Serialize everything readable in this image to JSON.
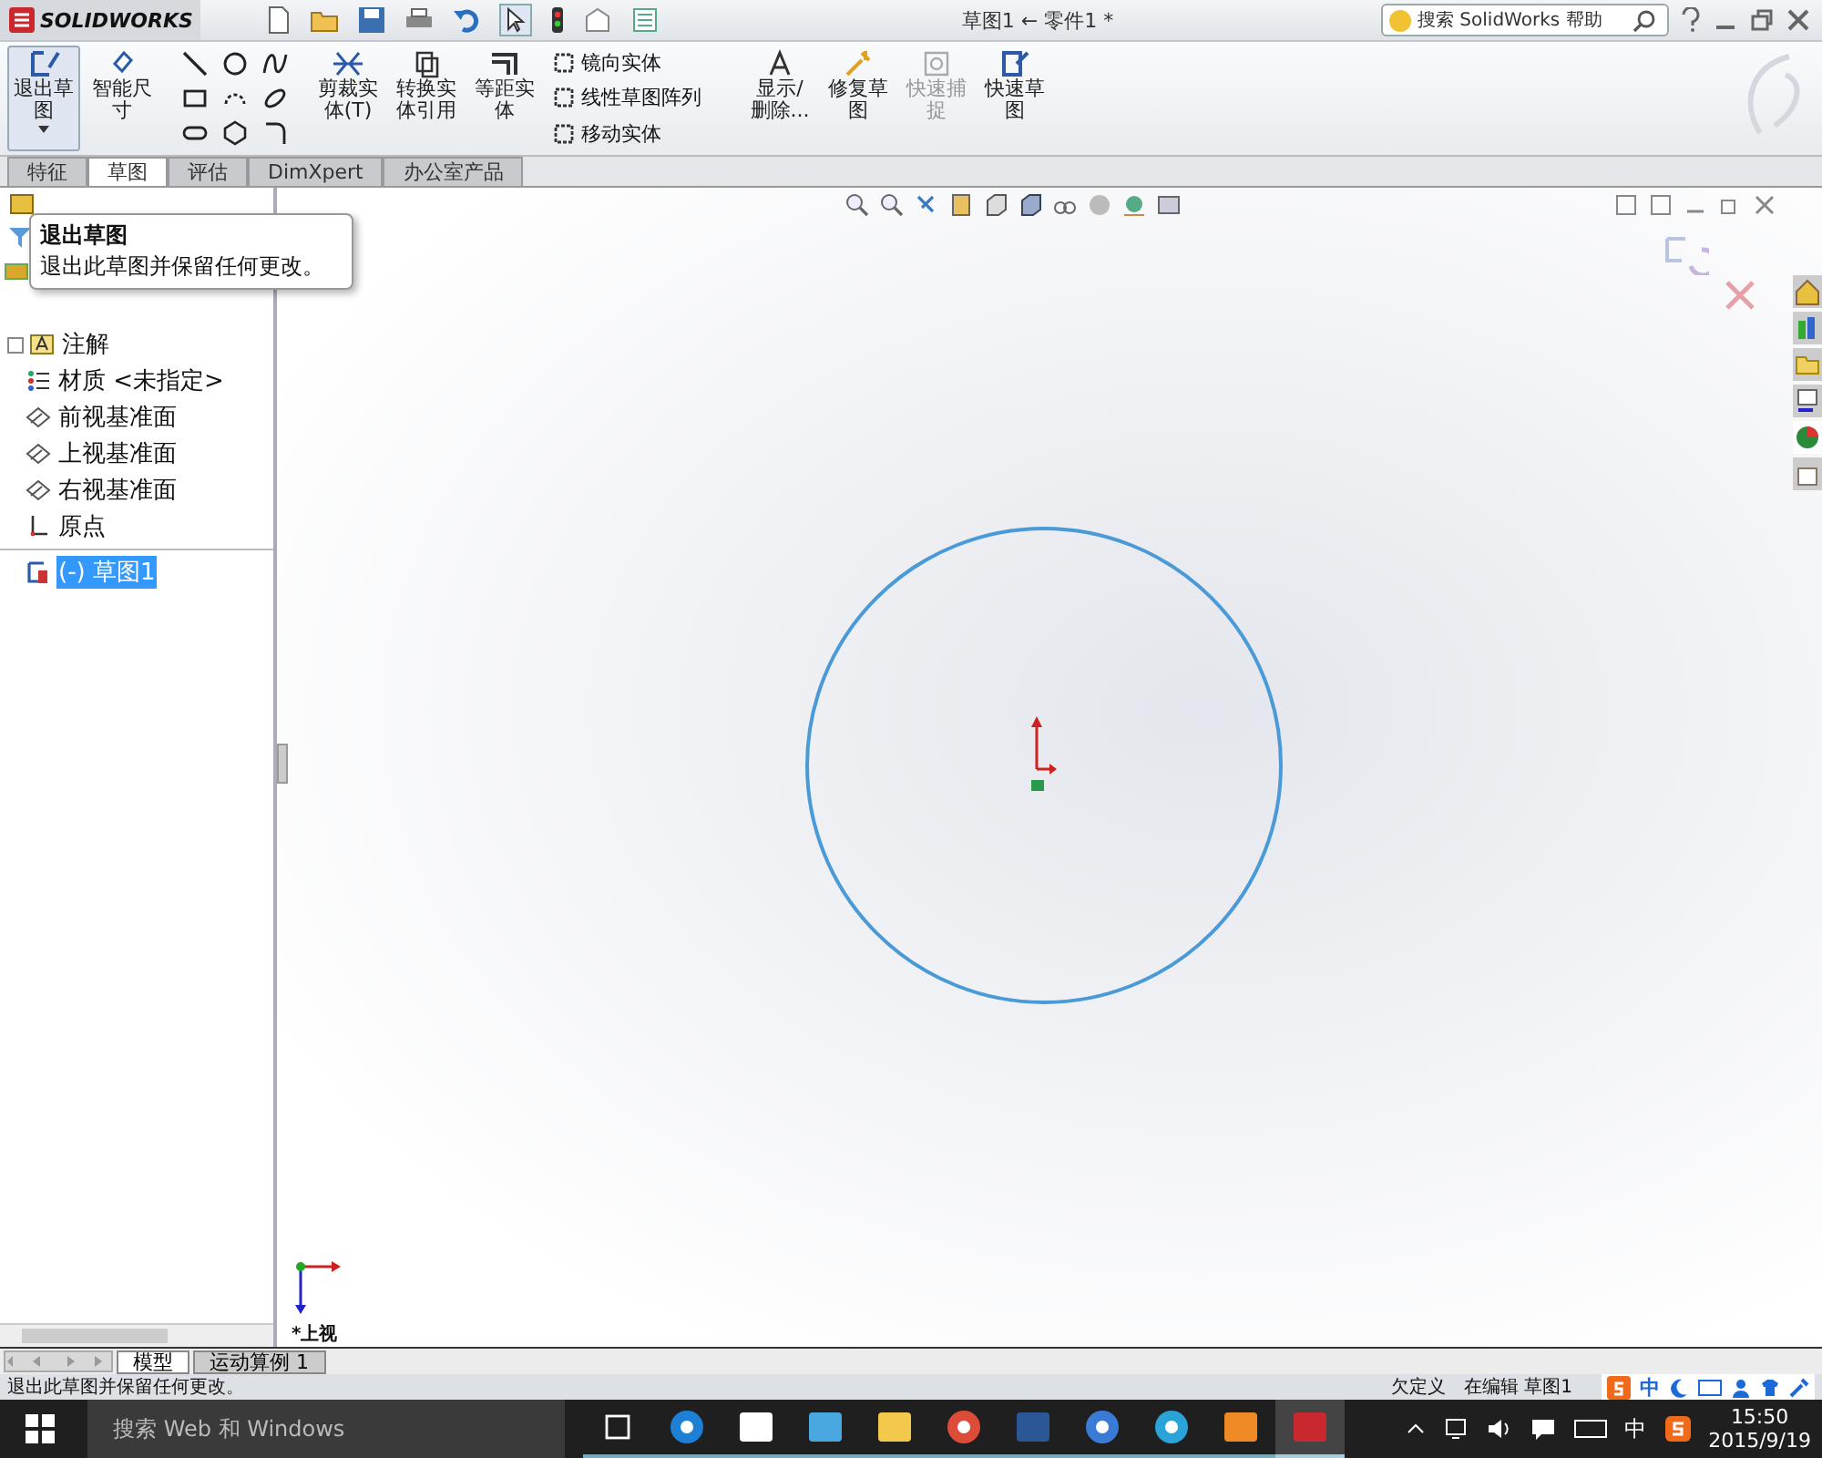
{
  "app": {
    "brand": "SOLIDWORKS",
    "title": "草图1 ← 零件1 *",
    "search": {
      "placeholder": "搜索 SolidWorks 帮助"
    }
  },
  "ribbon": {
    "items": [
      {
        "kind": "large",
        "label": "退出草图",
        "selected": true,
        "disabled": false
      },
      {
        "kind": "large",
        "label": "智能尺寸",
        "selected": false,
        "disabled": false
      },
      {
        "kind": "tools"
      },
      {
        "kind": "large",
        "label": "剪裁实体(T)",
        "selected": false,
        "disabled": false
      },
      {
        "kind": "large",
        "label": "转换实体引用",
        "selected": false,
        "disabled": false
      },
      {
        "kind": "large",
        "label": "等距实体",
        "selected": false,
        "disabled": false
      },
      {
        "kind": "list",
        "entries": [
          "镜向实体",
          "线性草图阵列",
          "移动实体"
        ]
      },
      {
        "kind": "large",
        "label": "显示/删除...",
        "selected": false,
        "disabled": false
      },
      {
        "kind": "large",
        "label": "修复草图",
        "selected": false,
        "disabled": false
      },
      {
        "kind": "large",
        "label": "快速捕捉",
        "selected": false,
        "disabled": true
      },
      {
        "kind": "large",
        "label": "快速草图",
        "selected": false,
        "disabled": false
      }
    ]
  },
  "tabs": [
    {
      "label": "特征",
      "selected": false
    },
    {
      "label": "草图",
      "selected": true
    },
    {
      "label": "评估",
      "selected": false
    },
    {
      "label": "DimXpert",
      "selected": false
    },
    {
      "label": "办公室产品",
      "selected": false
    }
  ],
  "tooltip": {
    "title": "退出草图",
    "body": "退出此草图并保留任何更改。"
  },
  "tree": [
    {
      "label": "注解",
      "kind": "annotation",
      "expandable": true,
      "selected": false
    },
    {
      "label": "材质 <未指定>",
      "kind": "material",
      "expandable": false,
      "selected": false
    },
    {
      "label": "前视基准面",
      "kind": "plane",
      "expandable": false,
      "selected": false
    },
    {
      "label": "上视基准面",
      "kind": "plane",
      "expandable": false,
      "selected": false
    },
    {
      "label": "右视基准面",
      "kind": "plane",
      "expandable": false,
      "selected": false
    },
    {
      "label": "原点",
      "kind": "origin",
      "expandable": false,
      "selected": false
    },
    {
      "label": "(-) 草图1",
      "kind": "sketch",
      "expandable": false,
      "selected": true
    }
  ],
  "view_label": "*上视",
  "bottom_tabs": [
    {
      "label": "模型",
      "selected": true
    },
    {
      "label": "运动算例 1",
      "selected": false
    }
  ],
  "status_bar": {
    "message": "退出此草图并保留任何更改。",
    "state": "欠定义",
    "mode": "在编辑 草图1",
    "ime": "中"
  },
  "taskbar": {
    "search": {
      "placeholder": "搜索 Web 和 Windows"
    },
    "apps": [
      {
        "kind": "taskview",
        "selected": false
      },
      {
        "kind": "edge",
        "selected": false
      },
      {
        "kind": "store",
        "selected": false
      },
      {
        "kind": "bird",
        "selected": false
      },
      {
        "kind": "folder",
        "selected": false
      },
      {
        "kind": "chrome",
        "selected": false
      },
      {
        "kind": "word",
        "selected": false
      },
      {
        "kind": "globe",
        "selected": false
      },
      {
        "kind": "kapp",
        "selected": false
      },
      {
        "kind": "doc",
        "selected": false
      },
      {
        "kind": "solidworks",
        "selected": true
      }
    ],
    "ime": "中",
    "time": "15:50",
    "date": "2015/9/19"
  }
}
